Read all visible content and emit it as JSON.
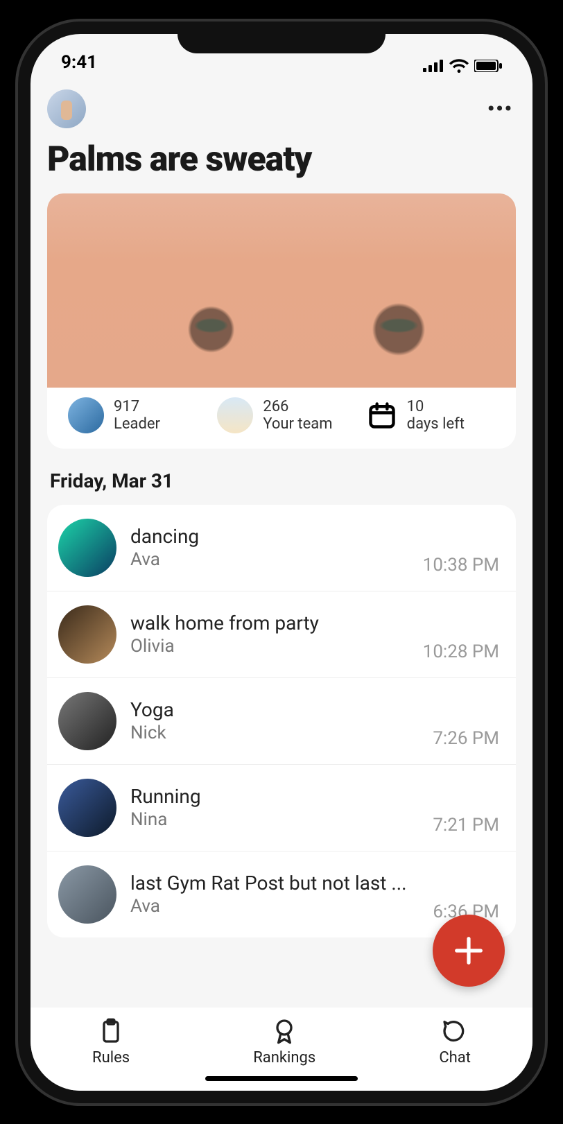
{
  "status": {
    "time": "9:41"
  },
  "header": {
    "title": "Palms are sweaty"
  },
  "stats": {
    "leader": {
      "value": "917",
      "label": "Leader"
    },
    "team": {
      "value": "266",
      "label": "Your team"
    },
    "days": {
      "value": "10",
      "label": "days left"
    }
  },
  "date_header": "Friday, Mar 31",
  "feed": [
    {
      "title": "dancing",
      "user": "Ava",
      "time": "10:38 PM"
    },
    {
      "title": "walk home from party",
      "user": "Olivia",
      "time": "10:28 PM"
    },
    {
      "title": "Yoga",
      "user": "Nick",
      "time": "7:26 PM"
    },
    {
      "title": "Running",
      "user": "Nina",
      "time": "7:21 PM"
    },
    {
      "title": "last Gym Rat Post but not last ...",
      "user": "Ava",
      "time": "6:36 PM"
    }
  ],
  "nav": {
    "rules": "Rules",
    "rankings": "Rankings",
    "chat": "Chat"
  }
}
